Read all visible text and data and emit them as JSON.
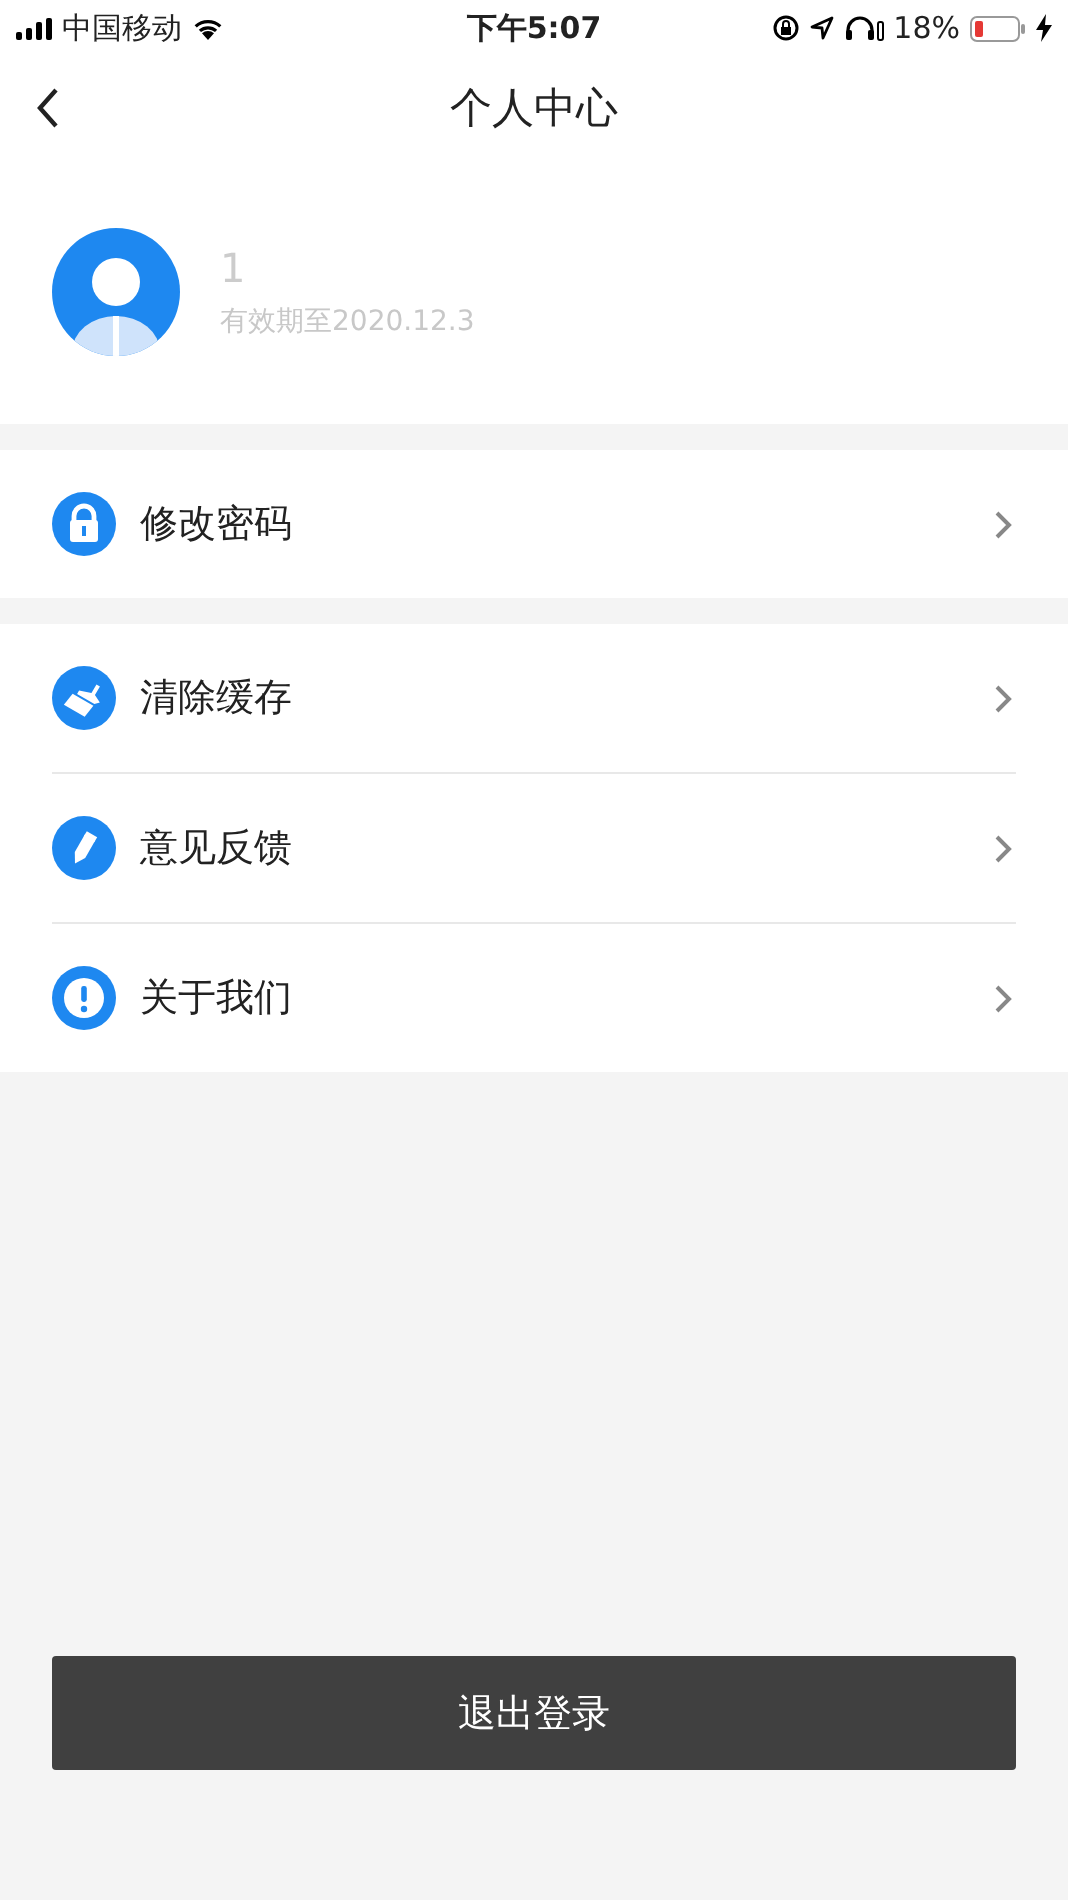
{
  "status_bar": {
    "carrier": "中国移动",
    "time": "下午5:07",
    "battery_percent": "18%"
  },
  "nav": {
    "title": "个人中心"
  },
  "profile": {
    "name": "1",
    "expiry": "有效期至2020.12.3"
  },
  "menu_groups": [
    {
      "items": [
        {
          "label": "修改密码",
          "kind": "lock"
        }
      ]
    },
    {
      "items": [
        {
          "label": "清除缓存",
          "kind": "brush"
        },
        {
          "label": "意见反馈",
          "kind": "pen"
        },
        {
          "label": "关于我们",
          "kind": "info"
        }
      ]
    }
  ],
  "logout_button": {
    "label": "退出登录"
  }
}
